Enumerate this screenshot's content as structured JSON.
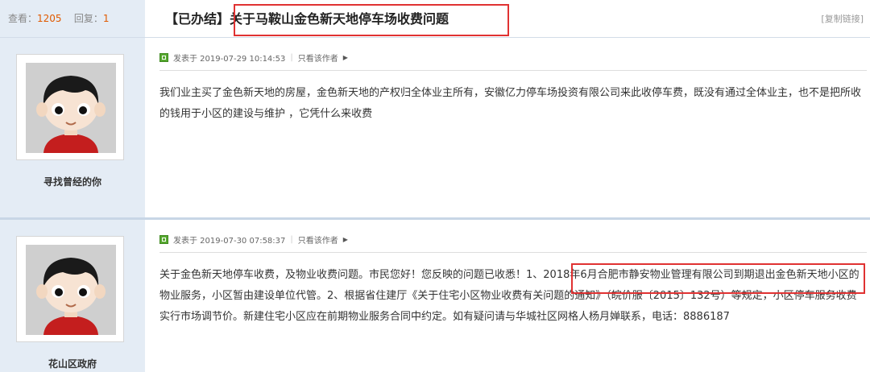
{
  "header": {
    "views_label": "查看：",
    "views": "1205",
    "replies_label": "回复：",
    "replies": "1",
    "status_tag": "【已办结】",
    "title": "关于马鞍山金色新天地停车场收费问题",
    "copy_link": "[复制链接]"
  },
  "posts": [
    {
      "author": "寻找曾经的你",
      "posted_at": "发表于 2019-07-29 10:14:53",
      "author_only": "只看该作者",
      "content": "我们业主买了金色新天地的房屋，金色新天地的产权归全体业主所有，安徽亿力停车场投资有限公司来此收停车费，既没有通过全体业主，也不是把所收的钱用于小区的建设与维护 ，它凭什么来收费"
    },
    {
      "author": "花山区政府",
      "posted_at": "发表于 2019-07-30 07:58:37",
      "author_only": "只看该作者",
      "content": "关于金色新天地停车收费，及物业收费问题。市民您好！您反映的问题已收悉！1、2018年6月合肥市静安物业管理有限公司到期退出金色新天地小区的物业服务，小区暂由建设单位代管。2、根据省住建厅《关于住宅小区物业收费有关问题的通知》（皖价服〔2015〕132号）等规定，小区停车服务收费实行市场调节价。新建住宅小区应在前期物业服务合同中约定。如有疑问请与华城社区网格人杨月婵联系，电话：8886187"
    }
  ]
}
